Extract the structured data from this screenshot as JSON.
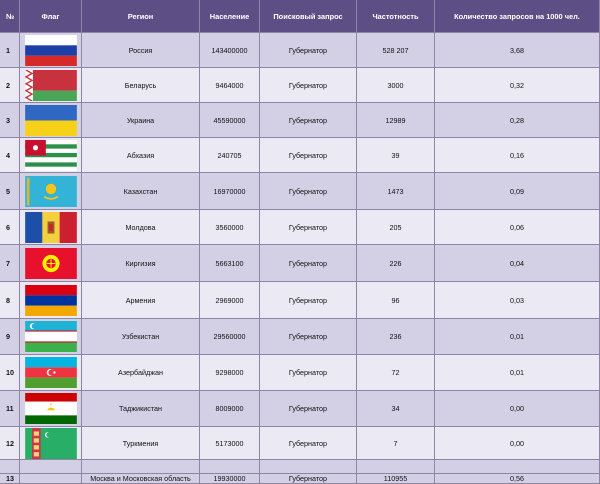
{
  "header": {
    "num": "№",
    "flag": "Флаг",
    "region": "Регион",
    "population": "Население",
    "query": "Поисковый запрос",
    "frequency": "Частотность",
    "per_thousand": "Количество запросов на 1000 чел."
  },
  "rows": [
    {
      "num": "1",
      "flag": "russia-flag",
      "region": "Россия",
      "population": "143400000",
      "query": "Губернатор",
      "frequency": "528 207",
      "per_thousand": "3,68"
    },
    {
      "num": "2",
      "flag": "belarus-flag",
      "region": "Беларусь",
      "population": "9464000",
      "query": "Губернатор",
      "frequency": "3000",
      "per_thousand": "0,32"
    },
    {
      "num": "3",
      "flag": "ukraine-flag",
      "region": "Украина",
      "population": "45590000",
      "query": "Губернатор",
      "frequency": "12989",
      "per_thousand": "0,28"
    },
    {
      "num": "4",
      "flag": "abkhazia-flag",
      "region": "Абхазия",
      "population": "240705",
      "query": "Губернатор",
      "frequency": "39",
      "per_thousand": "0,16"
    },
    {
      "num": "5",
      "flag": "kazakhstan-flag",
      "region": "Казахстан",
      "population": "16970000",
      "query": "Губернатор",
      "frequency": "1473",
      "per_thousand": "0,09"
    },
    {
      "num": "6",
      "flag": "moldova-flag",
      "region": "Молдова",
      "population": "3560000",
      "query": "Губернатор",
      "frequency": "205",
      "per_thousand": "0,06"
    },
    {
      "num": "7",
      "flag": "kyrgyzstan-flag",
      "region": "Киргизия",
      "population": "5663100",
      "query": "Губернатор",
      "frequency": "226",
      "per_thousand": "0,04"
    },
    {
      "num": "8",
      "flag": "armenia-flag",
      "region": "Армения",
      "population": "2969000",
      "query": "Губернатор",
      "frequency": "96",
      "per_thousand": "0,03"
    },
    {
      "num": "9",
      "flag": "uzbekistan-flag",
      "region": "Узбекистан",
      "population": "29560000",
      "query": "Губернатор",
      "frequency": "236",
      "per_thousand": "0,01"
    },
    {
      "num": "10",
      "flag": "azerbaijan-flag",
      "region": "Азербайджан",
      "population": "9298000",
      "query": "Губернатор",
      "frequency": "72",
      "per_thousand": "0,01"
    },
    {
      "num": "11",
      "flag": "tajikistan-flag",
      "region": "Таджикистан",
      "population": "8009000",
      "query": "Губернатор",
      "frequency": "34",
      "per_thousand": "0,00"
    },
    {
      "num": "12",
      "flag": "turkmenistan-flag",
      "region": "Туркмения",
      "population": "5173000",
      "query": "Губернатор",
      "frequency": "7",
      "per_thousand": "0,00"
    },
    {
      "num": "13",
      "flag": "",
      "region": "Москва и Московская область",
      "population": "19930000",
      "query": "Губернатор",
      "frequency": "110955",
      "per_thousand": "0,56"
    }
  ],
  "colors": {
    "header_bg": "#5d4f85",
    "row_light": "#ebe9f3",
    "row_dark": "#d3cfe4",
    "grid": "#8e84a6"
  }
}
